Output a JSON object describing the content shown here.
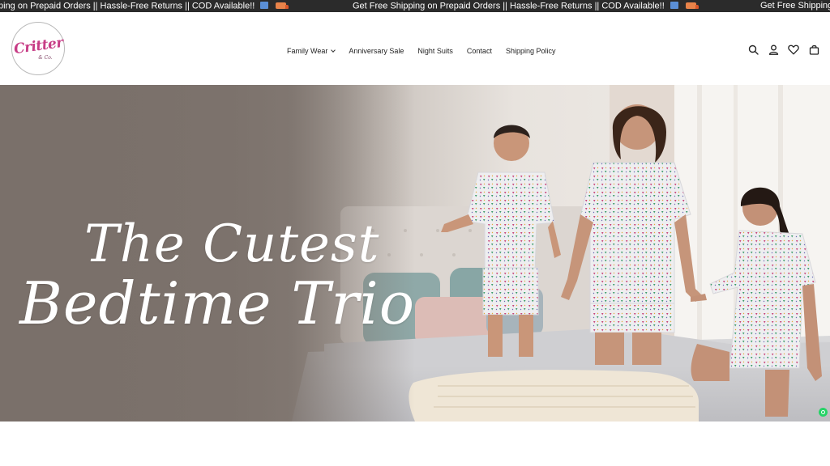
{
  "announcement": {
    "message": "Get Free Shipping on Prepaid Orders || Hassle-Free Returns || COD Available!!",
    "message_left_partial": "ping on Prepaid Orders || Hassle-Free Returns || COD Available!!",
    "message_right_partial": "Get Free Shipping",
    "emoji_icons": [
      "package-box-icon",
      "delivery-truck-icon"
    ]
  },
  "header": {
    "logo": {
      "text": "Critter",
      "subtext": "& Co."
    },
    "nav": [
      {
        "label": "Family Wear",
        "has_dropdown": true
      },
      {
        "label": "Anniversary Sale"
      },
      {
        "label": "Night Suits"
      },
      {
        "label": "Contact"
      },
      {
        "label": "Shipping Policy"
      }
    ],
    "icons": [
      "search-icon",
      "account-icon",
      "wishlist-heart-icon",
      "cart-bag-icon"
    ]
  },
  "hero": {
    "line1": "The Cutest",
    "line2": "Bedtime Trio"
  },
  "colors": {
    "announce_bg": "#2b2b2b",
    "logo_pink": "#c73d86",
    "hero_left": "#7d726b",
    "hero_right": "#ece6e1",
    "whatsapp": "#25d366"
  }
}
